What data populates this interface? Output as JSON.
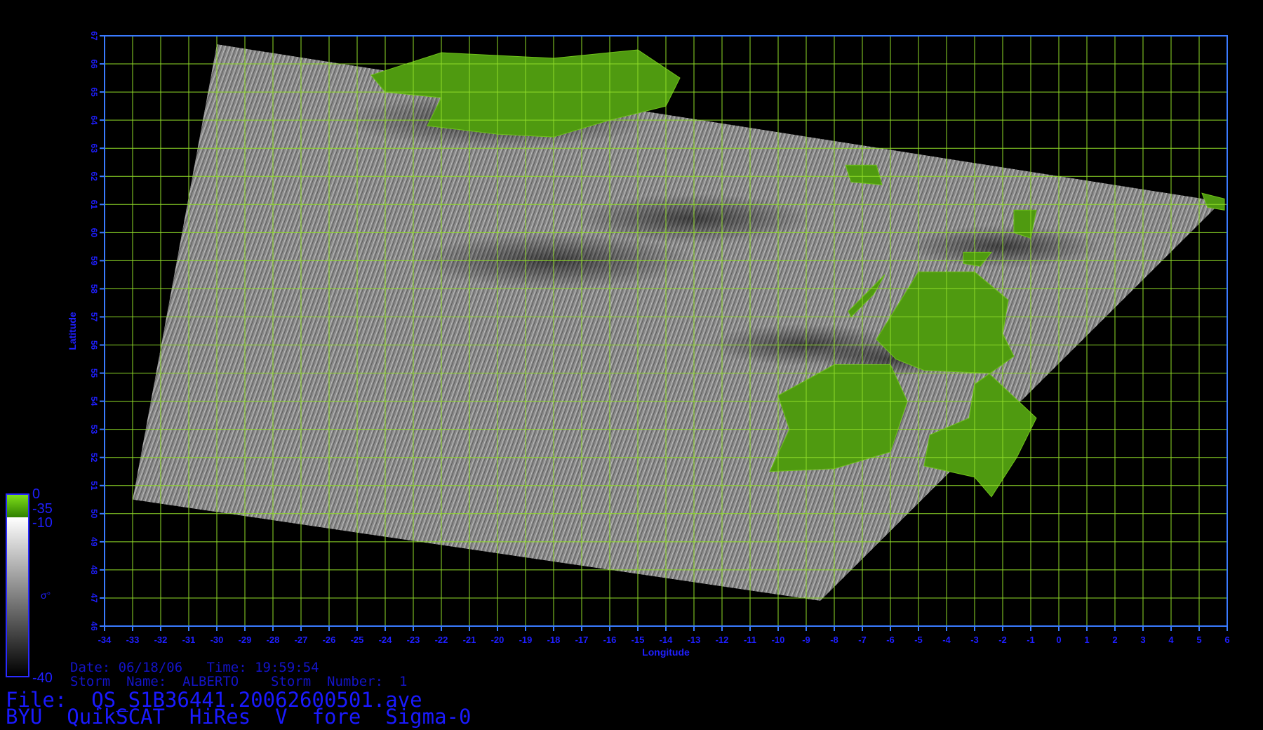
{
  "map": {
    "lon_ticks": [
      -34,
      -33,
      -32,
      -31,
      -30,
      -29,
      -28,
      -27,
      -26,
      -25,
      -24,
      -23,
      -22,
      -21,
      -20,
      -19,
      -18,
      -17,
      -16,
      -15,
      -14,
      -13,
      -12,
      -11,
      -10,
      -9,
      -8,
      -7,
      -6,
      -5,
      -4,
      -3,
      -2,
      -1,
      0,
      1,
      2,
      3,
      4,
      5,
      6
    ],
    "lat_ticks": [
      46,
      47,
      48,
      49,
      50,
      51,
      52,
      53,
      54,
      55,
      56,
      57,
      58,
      59,
      60,
      61,
      62,
      63,
      64,
      65,
      66,
      67
    ],
    "lon_range": [
      -34,
      6
    ],
    "lat_range": [
      46,
      67
    ],
    "xlabel": "Longitude",
    "ylabel": "Latitude",
    "grid": true,
    "colors": {
      "grid": "#8fdc28",
      "frame": "#3a7bff",
      "tick_text": "#1f1fff",
      "land": "#4f9a10",
      "background": "#000000"
    },
    "swath_corners": [
      [
        -30,
        66.7
      ],
      [
        -33,
        50.5
      ],
      [
        -8.5,
        46.9
      ],
      [
        5.8,
        61.1
      ]
    ]
  },
  "colorbar": {
    "symbol": "σ°",
    "land_top": "0",
    "land_bottom": "-35",
    "gray_top": "-10",
    "gray_bottom": "-40"
  },
  "info": {
    "date_line": "Date: 06/18/06   Time: 19:59:54",
    "storm_line": "Storm  Name:  ALBERTO    Storm  Number:  1",
    "file_line": "File:  QS_S1B36441.20062600501.ave",
    "product_line": "BYU  QuikSCAT  HiRes  V  fore  Sigma-0"
  }
}
